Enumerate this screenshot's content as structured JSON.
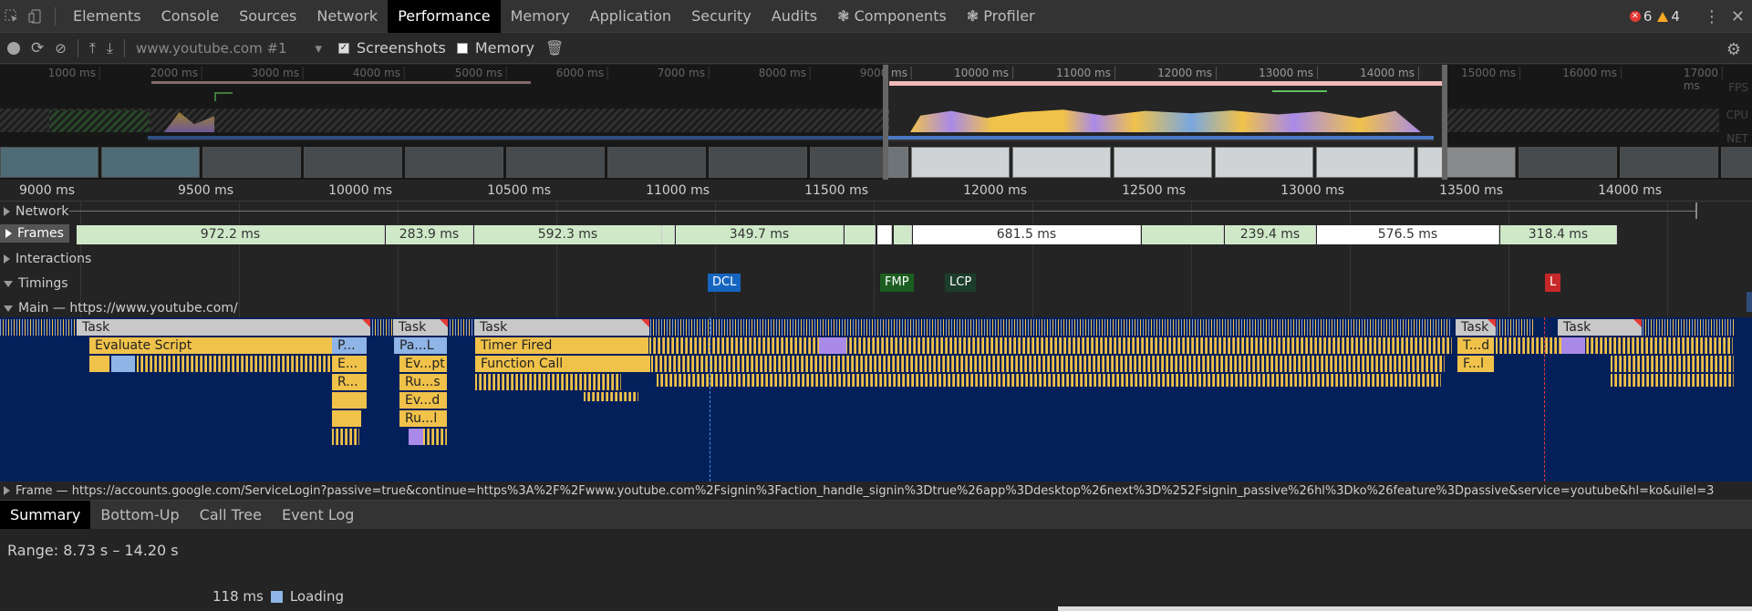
{
  "tabs": [
    "Elements",
    "Console",
    "Sources",
    "Network",
    "Performance",
    "Memory",
    "Application",
    "Security",
    "Audits",
    "❃ Components",
    "❃ Profiler"
  ],
  "active_tab": "Performance",
  "errors": "6",
  "warnings": "4",
  "toolbar": {
    "recording_select": "www.youtube.com #1",
    "screenshots_label": "Screenshots",
    "memory_label": "Memory"
  },
  "overview": {
    "ticks": [
      "1000 ms",
      "2000 ms",
      "3000 ms",
      "4000 ms",
      "5000 ms",
      "6000 ms",
      "7000 ms",
      "8000 ms",
      "9000 ms",
      "10000 ms",
      "11000 ms",
      "12000 ms",
      "13000 ms",
      "14000 ms",
      "15000 ms",
      "16000 ms",
      "17000 ms"
    ],
    "lane_labels": [
      "FPS",
      "CPU",
      "NET"
    ]
  },
  "ruler": {
    "ticks": [
      "9000 ms",
      "9500 ms",
      "10000 ms",
      "10500 ms",
      "11000 ms",
      "11500 ms",
      "12000 ms",
      "12500 ms",
      "13000 ms",
      "13500 ms",
      "14000 ms"
    ]
  },
  "tracks": {
    "network": "Network",
    "frames": "Frames",
    "interactions": "Interactions",
    "timings": "Timings",
    "main": "Main — https://www.youtube.com/",
    "frame": "Frame — https://accounts.google.com/ServiceLogin?passive=true&continue=https%3A%2F%2Fwww.youtube.com%2Fsignin%3Faction_handle_signin%3Dtrue%26app%3Ddesktop%26next%3D%252Fsignin_passive%26hl%3Dko%26feature%3Dpassive&service=youtube&hl=ko&uilel=3"
  },
  "frames": [
    "972.2 ms",
    "283.9 ms",
    "592.3 ms",
    "349.7 ms",
    "681.5 ms",
    "239.4 ms",
    "576.5 ms",
    "318.4 ms"
  ],
  "timings": [
    "DCL",
    "FMP",
    "LCP",
    "L"
  ],
  "main": {
    "tasks": [
      "Task",
      "Task",
      "Task",
      "Task",
      "Task"
    ],
    "events": {
      "evaluate_script": "Evaluate Script",
      "p": "P...",
      "pa_l": "Pa...L",
      "timer_fired": "Timer Fired",
      "t_d": "T...d",
      "e": "E...",
      "ev_pt": "Ev...pt",
      "function_call": "Function Call",
      "f_l": "F...l",
      "r": "R...",
      "ru_s": "Ru...s",
      "ev_d": "Ev...d",
      "ru_l": "Ru...l"
    }
  },
  "bottom_tabs": [
    "Summary",
    "Bottom-Up",
    "Call Tree",
    "Event Log"
  ],
  "range": "Range: 8.73 s – 14.20 s",
  "legend": {
    "value": "118 ms",
    "label": "Loading"
  },
  "colors": {
    "scripting": "#f0c24a",
    "loading": "#8fb4e6",
    "rendering": "#a98ae8",
    "dcl": "#1565c0",
    "fmp": "#1b5e20",
    "lcp": "#1b3d2a",
    "load": "#c62828"
  }
}
